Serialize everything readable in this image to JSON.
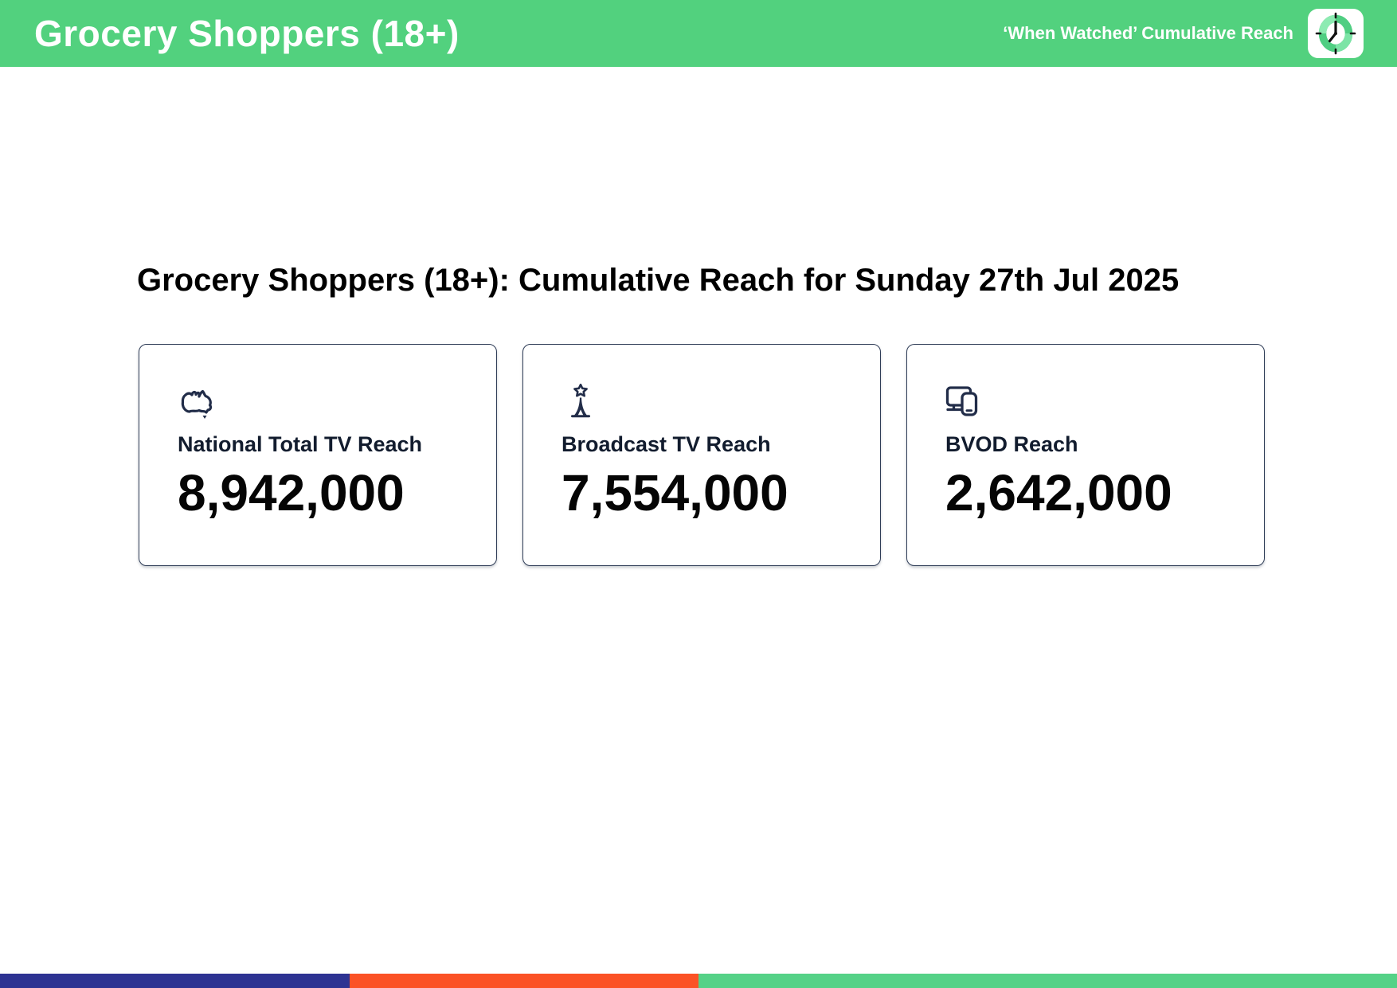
{
  "header": {
    "title": "Grocery Shoppers (18+)",
    "right_label": "‘When Watched’ Cumulative Reach",
    "icon": "clock-badge-icon",
    "bg_color": "#52d17e",
    "text_color": "#ffffff"
  },
  "main": {
    "heading": "Grocery Shoppers (18+): Cumulative Reach for Sunday 27th Jul 2025",
    "cards": [
      {
        "icon": "australia-map-icon",
        "label": "National Total TV Reach",
        "value": "8,942,000"
      },
      {
        "icon": "broadcast-tower-icon",
        "label": "Broadcast TV Reach",
        "value": "7,554,000"
      },
      {
        "icon": "devices-icon",
        "label": "BVOD Reach",
        "value": "2,642,000"
      }
    ]
  },
  "footer": {
    "segments": [
      {
        "name": "blue-segment",
        "color": "#2d3392",
        "width": "25%"
      },
      {
        "name": "orange-segment",
        "color": "#fb5226",
        "width": "25%"
      },
      {
        "name": "green-segment",
        "color": "#55d287",
        "width": "50%"
      }
    ]
  },
  "colors": {
    "card_border": "#2f3d57",
    "icon_navy": "#222d49",
    "heading_text": "#000000",
    "value_text": "#050505"
  }
}
